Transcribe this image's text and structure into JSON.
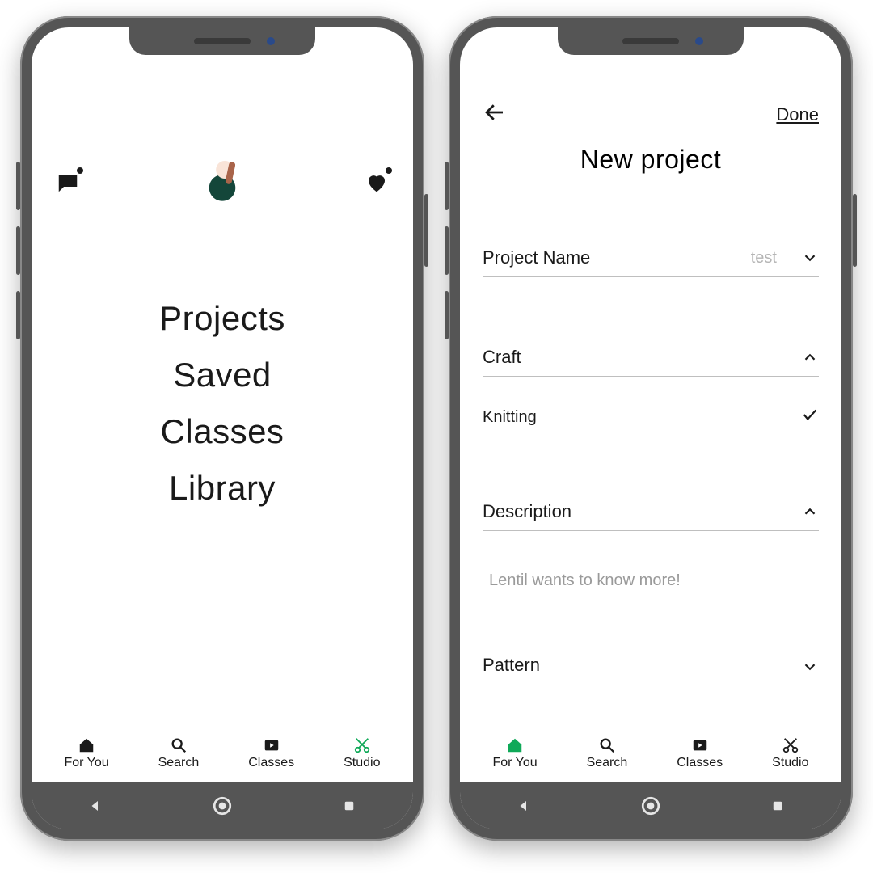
{
  "screen1": {
    "menu": [
      "Projects",
      "Saved",
      "Classes",
      "Library"
    ]
  },
  "tabs": [
    {
      "label": "For You",
      "icon": "home"
    },
    {
      "label": "Search",
      "icon": "search"
    },
    {
      "label": "Classes",
      "icon": "play"
    },
    {
      "label": "Studio",
      "icon": "scissors"
    }
  ],
  "screen2": {
    "done": "Done",
    "title": "New project",
    "fields": {
      "projectName": {
        "label": "Project Name",
        "value": "test"
      },
      "craft": {
        "label": "Craft",
        "option": "Knitting"
      },
      "description": {
        "label": "Description",
        "placeholder": "Lentil wants to know more!"
      },
      "pattern": {
        "label": "Pattern"
      }
    }
  }
}
